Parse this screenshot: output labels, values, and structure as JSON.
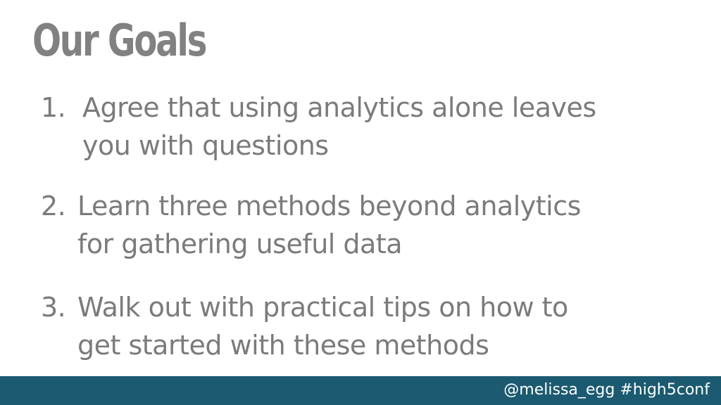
{
  "slide": {
    "title": "Our Goals",
    "goals": [
      {
        "number": "1.",
        "lines": [
          "Agree that using analytics alone leaves",
          "you with questions"
        ]
      },
      {
        "number": "2.",
        "lines": [
          "Learn three methods beyond analytics",
          "for gathering useful data"
        ]
      },
      {
        "number": "3.",
        "lines": [
          "Walk out with practical tips on how to",
          "get started with these methods"
        ]
      }
    ],
    "footer": "@melissa_egg #high5conf"
  },
  "colors": {
    "title": "#818181",
    "body_text": "#7b7b7b",
    "footer_bar": "#1b5a70",
    "footer_text": "#ffffff"
  }
}
